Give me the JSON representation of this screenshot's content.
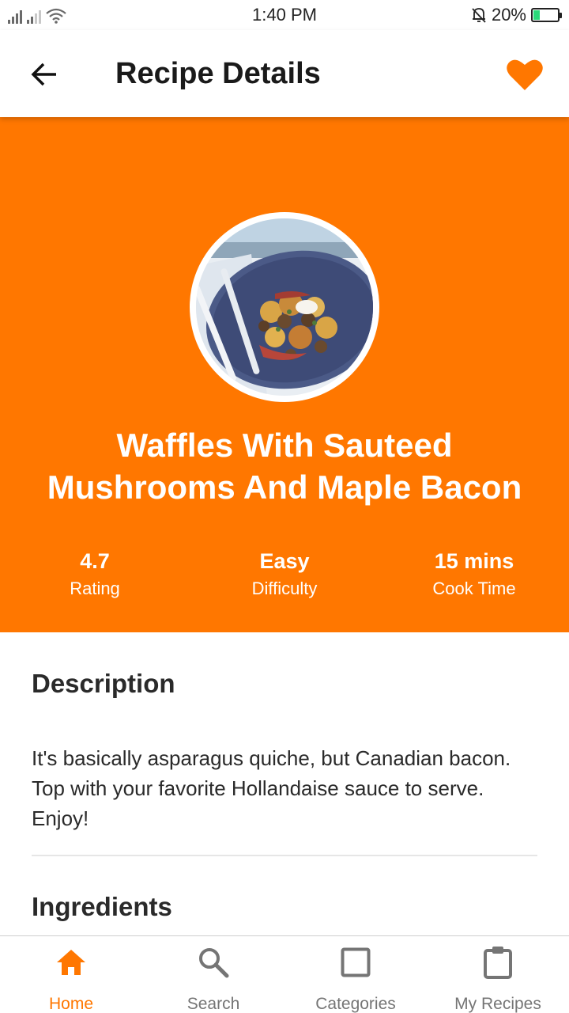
{
  "status_bar": {
    "time": "1:40 PM",
    "battery": "20%"
  },
  "app_bar": {
    "title": "Recipe Details",
    "back_icon": "arrow-left-icon",
    "favorite_icon": "heart-icon"
  },
  "colors": {
    "accent": "#ff7700",
    "text": "#2a2a2a",
    "inactive": "#757575"
  },
  "recipe": {
    "title": "Waffles With Sauteed Mushrooms And Maple Bacon",
    "stats": [
      {
        "value": "4.7",
        "label": "Rating"
      },
      {
        "value": "Easy",
        "label": "Difficulty"
      },
      {
        "value": "15 mins",
        "label": "Cook Time"
      }
    ],
    "description_heading": "Description",
    "description": "It's basically asparagus quiche, but Canadian bacon. Top with your favorite Hollandaise sauce to serve. Enjoy!",
    "ingredients_heading": "Ingredients"
  },
  "bottom_nav": [
    {
      "label": "Home",
      "icon": "home-icon",
      "active": true
    },
    {
      "label": "Search",
      "icon": "search-icon",
      "active": false
    },
    {
      "label": "Categories",
      "icon": "categories-icon",
      "active": false
    },
    {
      "label": "My Recipes",
      "icon": "clipboard-icon",
      "active": false
    }
  ]
}
